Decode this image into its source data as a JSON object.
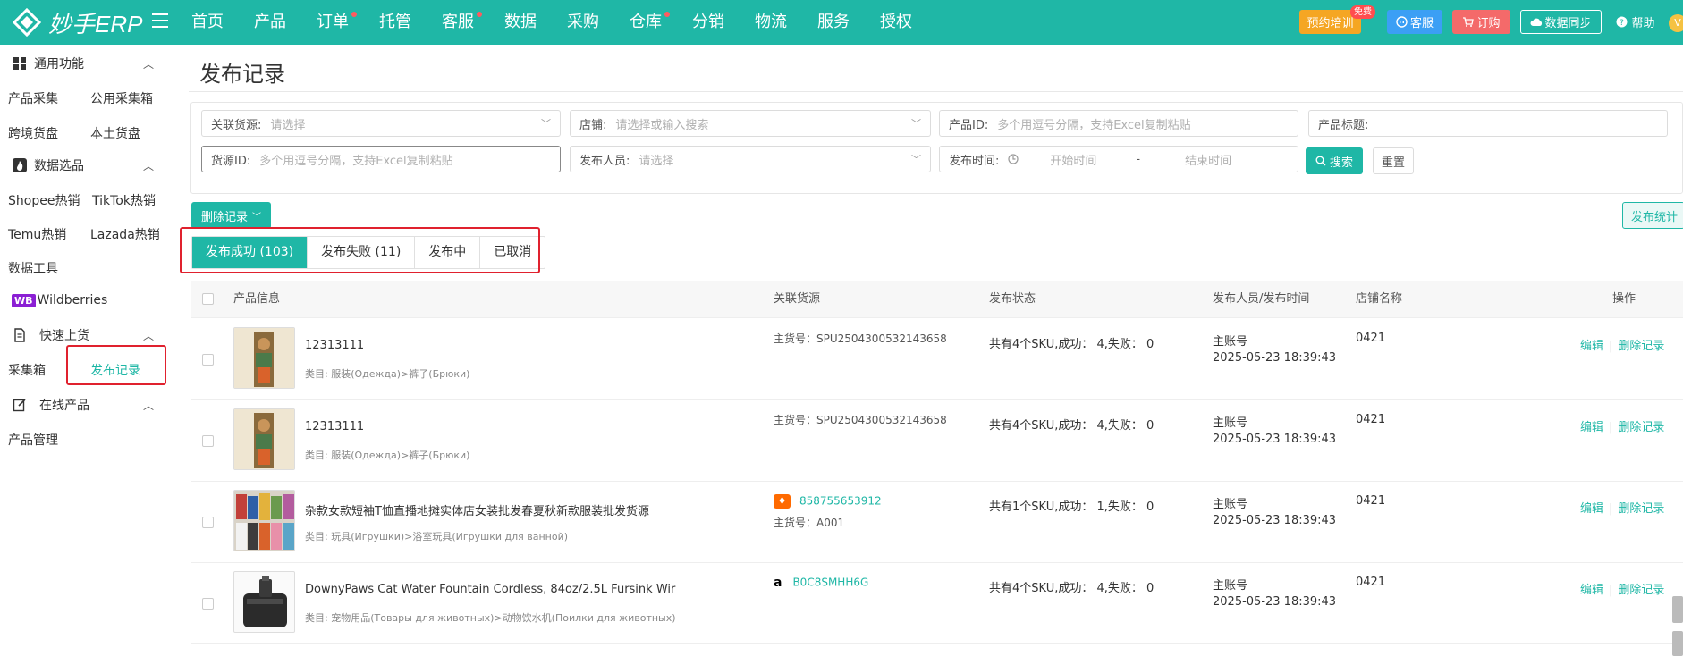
{
  "app": {
    "brand": "妙手ERP"
  },
  "nav": {
    "items": [
      {
        "label": "首页",
        "dot": false
      },
      {
        "label": "产品",
        "dot": false
      },
      {
        "label": "订单",
        "dot": true
      },
      {
        "label": "托管",
        "dot": false
      },
      {
        "label": "客服",
        "dot": true
      },
      {
        "label": "数据",
        "dot": false
      },
      {
        "label": "采购",
        "dot": false
      },
      {
        "label": "仓库",
        "dot": true
      },
      {
        "label": "分销",
        "dot": false
      },
      {
        "label": "物流",
        "dot": false
      },
      {
        "label": "服务",
        "dot": false
      },
      {
        "label": "授权",
        "dot": false
      }
    ]
  },
  "topbar": {
    "training": "预约培训",
    "free_badge": "免费",
    "customer_service": "客服",
    "subscribe": "订购",
    "data_sync": "数据同步",
    "help": "帮助",
    "avatar": "V"
  },
  "sidebar": {
    "general": {
      "title": "通用功能",
      "items": [
        "产品采集",
        "公用采集箱",
        "跨境货盘",
        "本土货盘"
      ]
    },
    "data_pick": {
      "title": "数据选品",
      "items": [
        "Shopee热销",
        "TikTok热销",
        "Temu热销",
        "Lazada热销",
        "数据工具"
      ]
    },
    "wb": {
      "badge": "WB",
      "label": "Wildberries"
    },
    "quick_listing": {
      "title": "快速上货",
      "items": [
        "采集箱",
        "发布记录"
      ]
    },
    "online_products": {
      "title": "在线产品",
      "items": [
        "产品管理"
      ]
    }
  },
  "page": {
    "title": "发布记录"
  },
  "filters": {
    "source": {
      "label": "关联货源:",
      "placeholder": "请选择"
    },
    "shop": {
      "label": "店铺:",
      "placeholder": "请选择或输入搜索"
    },
    "product_id": {
      "label": "产品ID:",
      "placeholder": "多个用逗号分隔，支持Excel复制粘贴"
    },
    "product_title": {
      "label": "产品标题:",
      "placeholder": ""
    },
    "source_id": {
      "label": "货源ID:",
      "placeholder": "多个用逗号分隔，支持Excel复制粘贴"
    },
    "publisher": {
      "label": "发布人员:",
      "placeholder": "请选择"
    },
    "publish_time": {
      "label": "发布时间:",
      "start": "开始时间",
      "sep": "-",
      "end": "结束时间"
    },
    "search": "搜索",
    "reset": "重置"
  },
  "toolbar": {
    "delete_records": "删除记录",
    "publish_stats": "发布统计"
  },
  "tabs": [
    "发布成功 (103)",
    "发布失败 (11)",
    "发布中",
    "已取消"
  ],
  "table": {
    "headers": [
      "产品信息",
      "关联货源",
      "发布状态",
      "发布人员/发布时间",
      "店铺名称",
      "操作"
    ],
    "rows": [
      {
        "title": "12313111",
        "category": "类目: 服装(Одежда)>裤子(Брюки)",
        "source_link": "",
        "source_main": "主货号：SPU2504300532143658",
        "source_icon": "",
        "status": "共有4个SKU,成功：  4,失败：  0",
        "publisher": "主账号",
        "time": "2025-05-23 18:39:43",
        "shop": "0421",
        "edit": "编辑",
        "delete": "删除记录",
        "thumb": "doll"
      },
      {
        "title": "12313111",
        "category": "类目: 服装(Одежда)>裤子(Брюки)",
        "source_link": "",
        "source_main": "主货号：SPU2504300532143658",
        "source_icon": "",
        "status": "共有4个SKU,成功：  4,失败：  0",
        "publisher": "主账号",
        "time": "2025-05-23 18:39:43",
        "shop": "0421",
        "edit": "编辑",
        "delete": "删除记录",
        "thumb": "doll"
      },
      {
        "title": "杂款女款短袖T恤直播地摊实体店女装批发春夏秋新款服装批发货源",
        "category": "类目: 玩具(Игрушки)>浴室玩具(Игрушки для ванной)",
        "source_link": "858755653912",
        "source_main": "主货号：A001",
        "source_icon": "1688",
        "status": "共有1个SKU,成功：  1,失败：  0",
        "publisher": "主账号",
        "time": "2025-05-23 18:39:43",
        "shop": "0421",
        "edit": "编辑",
        "delete": "删除记录",
        "thumb": "shirts"
      },
      {
        "title": "DownyPaws Cat Water Fountain Cordless, 84oz/2.5L Fursink Wir",
        "category": "类目: 宠物用品(Товары для животных)>动物饮水机(Поилки для животных)",
        "source_link": "B0C8SMHH6G",
        "source_main": "",
        "source_icon": "amazon",
        "status": "共有4个SKU,成功：  4,失败：  0",
        "publisher": "主账号",
        "time": "2025-05-23 18:39:43",
        "shop": "0421",
        "edit": "编辑",
        "delete": "删除记录",
        "thumb": "fountain"
      }
    ]
  }
}
